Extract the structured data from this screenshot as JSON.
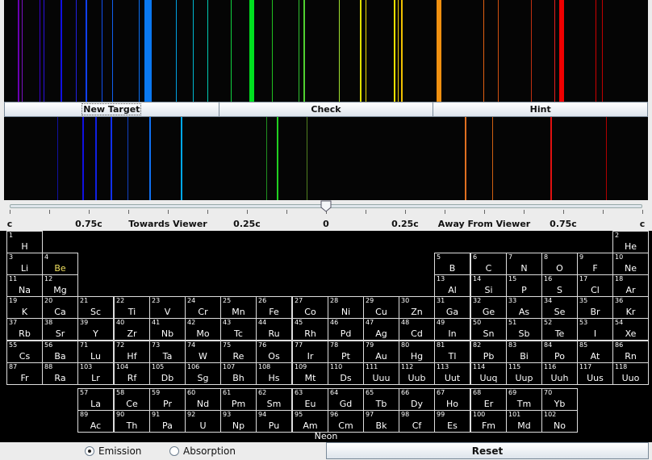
{
  "buttons": {
    "new_target": "New Target",
    "check": "Check",
    "hint": "Hint",
    "reset": "Reset"
  },
  "slider": {
    "labels": [
      "c",
      "0.75c",
      "Towards Viewer",
      "0.25c",
      "0",
      "0.25c",
      "Away From Viewer",
      "0.75c",
      "c"
    ],
    "value": 0.0,
    "range": [
      -1,
      1
    ]
  },
  "selected_element": "Neon",
  "radio": {
    "emission": "Emission",
    "absorption": "Absorption",
    "selected": "emission"
  },
  "target_spectrum": {
    "lines": [
      {
        "pos": 0.021,
        "w": 2,
        "color": "#6a00b0"
      },
      {
        "pos": 0.028,
        "w": 1,
        "color": "#7a10c0"
      },
      {
        "pos": 0.055,
        "w": 1,
        "color": "#3a00d0"
      },
      {
        "pos": 0.061,
        "w": 1,
        "color": "#2a10e0"
      },
      {
        "pos": 0.088,
        "w": 2,
        "color": "#1010e0"
      },
      {
        "pos": 0.112,
        "w": 1,
        "color": "#2020e0"
      },
      {
        "pos": 0.126,
        "w": 2,
        "color": "#1040f0"
      },
      {
        "pos": 0.152,
        "w": 1,
        "color": "#1050f0"
      },
      {
        "pos": 0.168,
        "w": 1,
        "color": "#1060f0"
      },
      {
        "pos": 0.209,
        "w": 1,
        "color": "#0a6ff0"
      },
      {
        "pos": 0.218,
        "w": 9,
        "color": "#0a78f0"
      },
      {
        "pos": 0.267,
        "w": 1,
        "color": "#00a0e0"
      },
      {
        "pos": 0.293,
        "w": 1,
        "color": "#00b8d0"
      },
      {
        "pos": 0.316,
        "w": 1,
        "color": "#00c8b0"
      },
      {
        "pos": 0.352,
        "w": 1,
        "color": "#10d040"
      },
      {
        "pos": 0.381,
        "w": 6,
        "color": "#00e020"
      },
      {
        "pos": 0.416,
        "w": 1,
        "color": "#20c020"
      },
      {
        "pos": 0.457,
        "w": 1,
        "color": "#30c030"
      },
      {
        "pos": 0.465,
        "w": 2,
        "color": "#50d030"
      },
      {
        "pos": 0.52,
        "w": 1,
        "color": "#a0e030"
      },
      {
        "pos": 0.553,
        "w": 2,
        "color": "#e0e000"
      },
      {
        "pos": 0.561,
        "w": 1,
        "color": "#f0e000"
      },
      {
        "pos": 0.605,
        "w": 2,
        "color": "#f0e000"
      },
      {
        "pos": 0.612,
        "w": 1,
        "color": "#f0d000"
      },
      {
        "pos": 0.617,
        "w": 2,
        "color": "#f0c000"
      },
      {
        "pos": 0.672,
        "w": 6,
        "color": "#f09010"
      },
      {
        "pos": 0.744,
        "w": 1,
        "color": "#e06010"
      },
      {
        "pos": 0.767,
        "w": 1,
        "color": "#d05010"
      },
      {
        "pos": 0.818,
        "w": 1,
        "color": "#c03010"
      },
      {
        "pos": 0.855,
        "w": 1,
        "color": "#e02020"
      },
      {
        "pos": 0.862,
        "w": 6,
        "color": "#f00000"
      },
      {
        "pos": 0.918,
        "w": 1,
        "color": "#d00000"
      },
      {
        "pos": 0.928,
        "w": 1,
        "color": "#c00000"
      }
    ]
  },
  "test_spectrum": {
    "lines": [
      {
        "pos": 0.083,
        "w": 1,
        "color": "#1010a0"
      },
      {
        "pos": 0.122,
        "w": 2,
        "color": "#1010e0"
      },
      {
        "pos": 0.142,
        "w": 2,
        "color": "#1020e0"
      },
      {
        "pos": 0.166,
        "w": 2,
        "color": "#1030f0"
      },
      {
        "pos": 0.192,
        "w": 1,
        "color": "#1040c0"
      },
      {
        "pos": 0.225,
        "w": 2,
        "color": "#1070f0"
      },
      {
        "pos": 0.275,
        "w": 2,
        "color": "#00a8e8"
      },
      {
        "pos": 0.407,
        "w": 1,
        "color": "#209020"
      },
      {
        "pos": 0.423,
        "w": 2,
        "color": "#20d020"
      },
      {
        "pos": 0.47,
        "w": 1,
        "color": "#508020"
      },
      {
        "pos": 0.715,
        "w": 2,
        "color": "#e07020"
      },
      {
        "pos": 0.758,
        "w": 1,
        "color": "#d06010"
      },
      {
        "pos": 0.848,
        "w": 2,
        "color": "#e01010"
      },
      {
        "pos": 0.935,
        "w": 1,
        "color": "#b00000"
      }
    ]
  },
  "periodic_table": [
    {
      "n": "1",
      "s": "H",
      "r": 1,
      "c": 1
    },
    {
      "n": "2",
      "s": "He",
      "r": 1,
      "c": 18
    },
    {
      "n": "3",
      "s": "Li",
      "r": 2,
      "c": 1
    },
    {
      "n": "4",
      "s": "Be",
      "r": 2,
      "c": 2,
      "sel": true
    },
    {
      "n": "5",
      "s": "B",
      "r": 2,
      "c": 13
    },
    {
      "n": "6",
      "s": "C",
      "r": 2,
      "c": 14
    },
    {
      "n": "7",
      "s": "N",
      "r": 2,
      "c": 15
    },
    {
      "n": "8",
      "s": "O",
      "r": 2,
      "c": 16
    },
    {
      "n": "9",
      "s": "F",
      "r": 2,
      "c": 17
    },
    {
      "n": "10",
      "s": "Ne",
      "r": 2,
      "c": 18
    },
    {
      "n": "11",
      "s": "Na",
      "r": 3,
      "c": 1
    },
    {
      "n": "12",
      "s": "Mg",
      "r": 3,
      "c": 2
    },
    {
      "n": "13",
      "s": "Al",
      "r": 3,
      "c": 13
    },
    {
      "n": "14",
      "s": "Si",
      "r": 3,
      "c": 14
    },
    {
      "n": "15",
      "s": "P",
      "r": 3,
      "c": 15
    },
    {
      "n": "16",
      "s": "S",
      "r": 3,
      "c": 16
    },
    {
      "n": "17",
      "s": "Cl",
      "r": 3,
      "c": 17
    },
    {
      "n": "18",
      "s": "Ar",
      "r": 3,
      "c": 18
    },
    {
      "n": "19",
      "s": "K",
      "r": 4,
      "c": 1
    },
    {
      "n": "20",
      "s": "Ca",
      "r": 4,
      "c": 2
    },
    {
      "n": "21",
      "s": "Sc",
      "r": 4,
      "c": 3
    },
    {
      "n": "22",
      "s": "Ti",
      "r": 4,
      "c": 4
    },
    {
      "n": "23",
      "s": "V",
      "r": 4,
      "c": 5
    },
    {
      "n": "24",
      "s": "Cr",
      "r": 4,
      "c": 6
    },
    {
      "n": "25",
      "s": "Mn",
      "r": 4,
      "c": 7
    },
    {
      "n": "26",
      "s": "Fe",
      "r": 4,
      "c": 8
    },
    {
      "n": "27",
      "s": "Co",
      "r": 4,
      "c": 9
    },
    {
      "n": "28",
      "s": "Ni",
      "r": 4,
      "c": 10
    },
    {
      "n": "29",
      "s": "Cu",
      "r": 4,
      "c": 11
    },
    {
      "n": "30",
      "s": "Zn",
      "r": 4,
      "c": 12
    },
    {
      "n": "31",
      "s": "Ga",
      "r": 4,
      "c": 13
    },
    {
      "n": "32",
      "s": "Ge",
      "r": 4,
      "c": 14
    },
    {
      "n": "33",
      "s": "As",
      "r": 4,
      "c": 15
    },
    {
      "n": "34",
      "s": "Se",
      "r": 4,
      "c": 16
    },
    {
      "n": "35",
      "s": "Br",
      "r": 4,
      "c": 17
    },
    {
      "n": "36",
      "s": "Kr",
      "r": 4,
      "c": 18
    },
    {
      "n": "37",
      "s": "Rb",
      "r": 5,
      "c": 1
    },
    {
      "n": "38",
      "s": "Sr",
      "r": 5,
      "c": 2
    },
    {
      "n": "39",
      "s": "Y",
      "r": 5,
      "c": 3
    },
    {
      "n": "40",
      "s": "Zr",
      "r": 5,
      "c": 4
    },
    {
      "n": "41",
      "s": "Nb",
      "r": 5,
      "c": 5
    },
    {
      "n": "42",
      "s": "Mo",
      "r": 5,
      "c": 6
    },
    {
      "n": "43",
      "s": "Tc",
      "r": 5,
      "c": 7
    },
    {
      "n": "44",
      "s": "Ru",
      "r": 5,
      "c": 8
    },
    {
      "n": "45",
      "s": "Rh",
      "r": 5,
      "c": 9
    },
    {
      "n": "46",
      "s": "Pd",
      "r": 5,
      "c": 10
    },
    {
      "n": "47",
      "s": "Ag",
      "r": 5,
      "c": 11
    },
    {
      "n": "48",
      "s": "Cd",
      "r": 5,
      "c": 12
    },
    {
      "n": "49",
      "s": "In",
      "r": 5,
      "c": 13
    },
    {
      "n": "50",
      "s": "Sn",
      "r": 5,
      "c": 14
    },
    {
      "n": "51",
      "s": "Sb",
      "r": 5,
      "c": 15
    },
    {
      "n": "52",
      "s": "Te",
      "r": 5,
      "c": 16
    },
    {
      "n": "53",
      "s": "I",
      "r": 5,
      "c": 17
    },
    {
      "n": "54",
      "s": "Xe",
      "r": 5,
      "c": 18
    },
    {
      "n": "55",
      "s": "Cs",
      "r": 6,
      "c": 1
    },
    {
      "n": "56",
      "s": "Ba",
      "r": 6,
      "c": 2
    },
    {
      "n": "71",
      "s": "Lu",
      "r": 6,
      "c": 3
    },
    {
      "n": "72",
      "s": "Hf",
      "r": 6,
      "c": 4
    },
    {
      "n": "73",
      "s": "Ta",
      "r": 6,
      "c": 5
    },
    {
      "n": "74",
      "s": "W",
      "r": 6,
      "c": 6
    },
    {
      "n": "75",
      "s": "Re",
      "r": 6,
      "c": 7
    },
    {
      "n": "76",
      "s": "Os",
      "r": 6,
      "c": 8
    },
    {
      "n": "77",
      "s": "Ir",
      "r": 6,
      "c": 9
    },
    {
      "n": "78",
      "s": "Pt",
      "r": 6,
      "c": 10
    },
    {
      "n": "79",
      "s": "Au",
      "r": 6,
      "c": 11
    },
    {
      "n": "80",
      "s": "Hg",
      "r": 6,
      "c": 12
    },
    {
      "n": "81",
      "s": "Tl",
      "r": 6,
      "c": 13
    },
    {
      "n": "82",
      "s": "Pb",
      "r": 6,
      "c": 14
    },
    {
      "n": "83",
      "s": "Bi",
      "r": 6,
      "c": 15
    },
    {
      "n": "84",
      "s": "Po",
      "r": 6,
      "c": 16
    },
    {
      "n": "85",
      "s": "At",
      "r": 6,
      "c": 17
    },
    {
      "n": "86",
      "s": "Rn",
      "r": 6,
      "c": 18
    },
    {
      "n": "87",
      "s": "Fr",
      "r": 7,
      "c": 1
    },
    {
      "n": "88",
      "s": "Ra",
      "r": 7,
      "c": 2
    },
    {
      "n": "103",
      "s": "Lr",
      "r": 7,
      "c": 3
    },
    {
      "n": "104",
      "s": "Rf",
      "r": 7,
      "c": 4
    },
    {
      "n": "105",
      "s": "Db",
      "r": 7,
      "c": 5
    },
    {
      "n": "106",
      "s": "Sg",
      "r": 7,
      "c": 6
    },
    {
      "n": "107",
      "s": "Bh",
      "r": 7,
      "c": 7
    },
    {
      "n": "108",
      "s": "Hs",
      "r": 7,
      "c": 8
    },
    {
      "n": "109",
      "s": "Mt",
      "r": 7,
      "c": 9
    },
    {
      "n": "110",
      "s": "Ds",
      "r": 7,
      "c": 10
    },
    {
      "n": "111",
      "s": "Uuu",
      "r": 7,
      "c": 11
    },
    {
      "n": "112",
      "s": "Uub",
      "r": 7,
      "c": 12
    },
    {
      "n": "113",
      "s": "Uut",
      "r": 7,
      "c": 13
    },
    {
      "n": "114",
      "s": "Uuq",
      "r": 7,
      "c": 14
    },
    {
      "n": "115",
      "s": "Uup",
      "r": 7,
      "c": 15
    },
    {
      "n": "116",
      "s": "Uuh",
      "r": 7,
      "c": 16
    },
    {
      "n": "117",
      "s": "Uus",
      "r": 7,
      "c": 17
    },
    {
      "n": "118",
      "s": "Uuo",
      "r": 7,
      "c": 18
    },
    {
      "n": "57",
      "s": "La",
      "r": 8,
      "c": 3
    },
    {
      "n": "58",
      "s": "Ce",
      "r": 8,
      "c": 4
    },
    {
      "n": "59",
      "s": "Pr",
      "r": 8,
      "c": 5
    },
    {
      "n": "60",
      "s": "Nd",
      "r": 8,
      "c": 6
    },
    {
      "n": "61",
      "s": "Pm",
      "r": 8,
      "c": 7
    },
    {
      "n": "62",
      "s": "Sm",
      "r": 8,
      "c": 8
    },
    {
      "n": "63",
      "s": "Eu",
      "r": 8,
      "c": 9
    },
    {
      "n": "64",
      "s": "Gd",
      "r": 8,
      "c": 10
    },
    {
      "n": "65",
      "s": "Tb",
      "r": 8,
      "c": 11
    },
    {
      "n": "66",
      "s": "Dy",
      "r": 8,
      "c": 12
    },
    {
      "n": "67",
      "s": "Ho",
      "r": 8,
      "c": 13
    },
    {
      "n": "68",
      "s": "Er",
      "r": 8,
      "c": 14
    },
    {
      "n": "69",
      "s": "Tm",
      "r": 8,
      "c": 15
    },
    {
      "n": "70",
      "s": "Yb",
      "r": 8,
      "c": 16
    },
    {
      "n": "89",
      "s": "Ac",
      "r": 9,
      "c": 3
    },
    {
      "n": "90",
      "s": "Th",
      "r": 9,
      "c": 4
    },
    {
      "n": "91",
      "s": "Pa",
      "r": 9,
      "c": 5
    },
    {
      "n": "92",
      "s": "U",
      "r": 9,
      "c": 6
    },
    {
      "n": "93",
      "s": "Np",
      "r": 9,
      "c": 7
    },
    {
      "n": "94",
      "s": "Pu",
      "r": 9,
      "c": 8
    },
    {
      "n": "95",
      "s": "Am",
      "r": 9,
      "c": 9
    },
    {
      "n": "96",
      "s": "Cm",
      "r": 9,
      "c": 10
    },
    {
      "n": "97",
      "s": "Bk",
      "r": 9,
      "c": 11
    },
    {
      "n": "98",
      "s": "Cf",
      "r": 9,
      "c": 12
    },
    {
      "n": "99",
      "s": "Es",
      "r": 9,
      "c": 13
    },
    {
      "n": "100",
      "s": "Fm",
      "r": 9,
      "c": 14
    },
    {
      "n": "101",
      "s": "Md",
      "r": 9,
      "c": 15
    },
    {
      "n": "102",
      "s": "No",
      "r": 9,
      "c": 16
    }
  ]
}
